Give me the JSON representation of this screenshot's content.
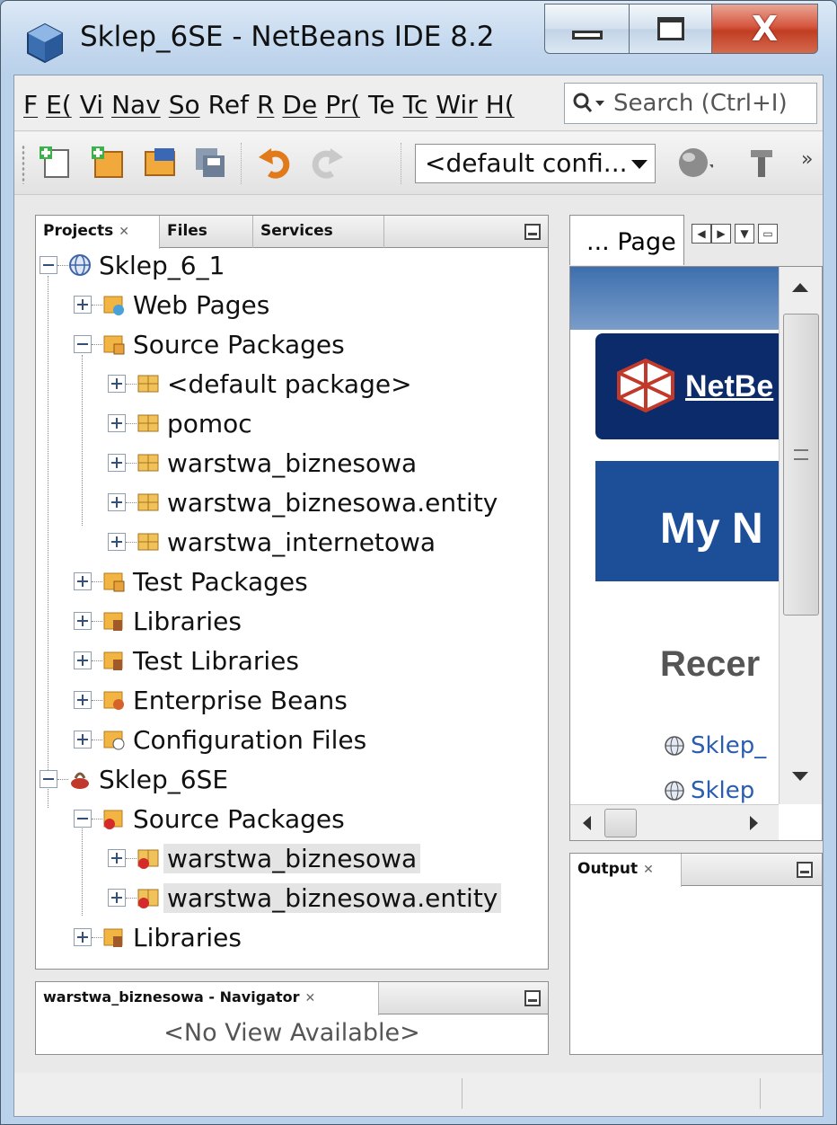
{
  "window": {
    "title": "Sklep_6SE - NetBeans IDE 8.2",
    "close_glyph": "X"
  },
  "menu": {
    "items": [
      "F",
      "E(",
      "Vi",
      "Nav",
      "So",
      "Ref",
      "R",
      "De",
      "Pr(",
      "Te",
      "Tc",
      "Wir",
      "H("
    ]
  },
  "search": {
    "placeholder": "Search (Ctrl+I)"
  },
  "toolbar": {
    "config_value": "<default confi...",
    "icons": [
      "new-file-icon",
      "new-project-icon",
      "open-project-icon",
      "save-all-icon",
      "undo-icon",
      "redo-icon",
      "globe-icon",
      "build-icon"
    ],
    "more": "»"
  },
  "projects_panel": {
    "tabs": [
      "Projects",
      "Files",
      "Services"
    ],
    "close_mark": "✕",
    "tree": [
      {
        "label": "Sklep_6_1"
      },
      {
        "label": "Web Pages"
      },
      {
        "label": "Source Packages"
      },
      {
        "label": "<default package>"
      },
      {
        "label": "pomoc"
      },
      {
        "label": "warstwa_biznesowa"
      },
      {
        "label": "warstwa_biznesowa.entity"
      },
      {
        "label": "warstwa_internetowa"
      },
      {
        "label": "Test Packages"
      },
      {
        "label": "Libraries"
      },
      {
        "label": "Test Libraries"
      },
      {
        "label": "Enterprise Beans"
      },
      {
        "label": "Configuration Files"
      },
      {
        "label": "Sklep_6SE"
      },
      {
        "label": "Source Packages"
      },
      {
        "label": "warstwa_biznesowa"
      },
      {
        "label": "warstwa_biznesowa.entity"
      },
      {
        "label": "Libraries"
      }
    ]
  },
  "navigator_panel": {
    "tab": "warstwa_biznesowa - Navigator",
    "content": "<No View Available>"
  },
  "page_panel": {
    "tab": "... Page",
    "web": {
      "banner": "NetBe",
      "hero": "My N",
      "recent": "Recer",
      "links": [
        "Sklep_",
        "Sklep"
      ]
    }
  },
  "output_panel": {
    "tab": "Output"
  }
}
